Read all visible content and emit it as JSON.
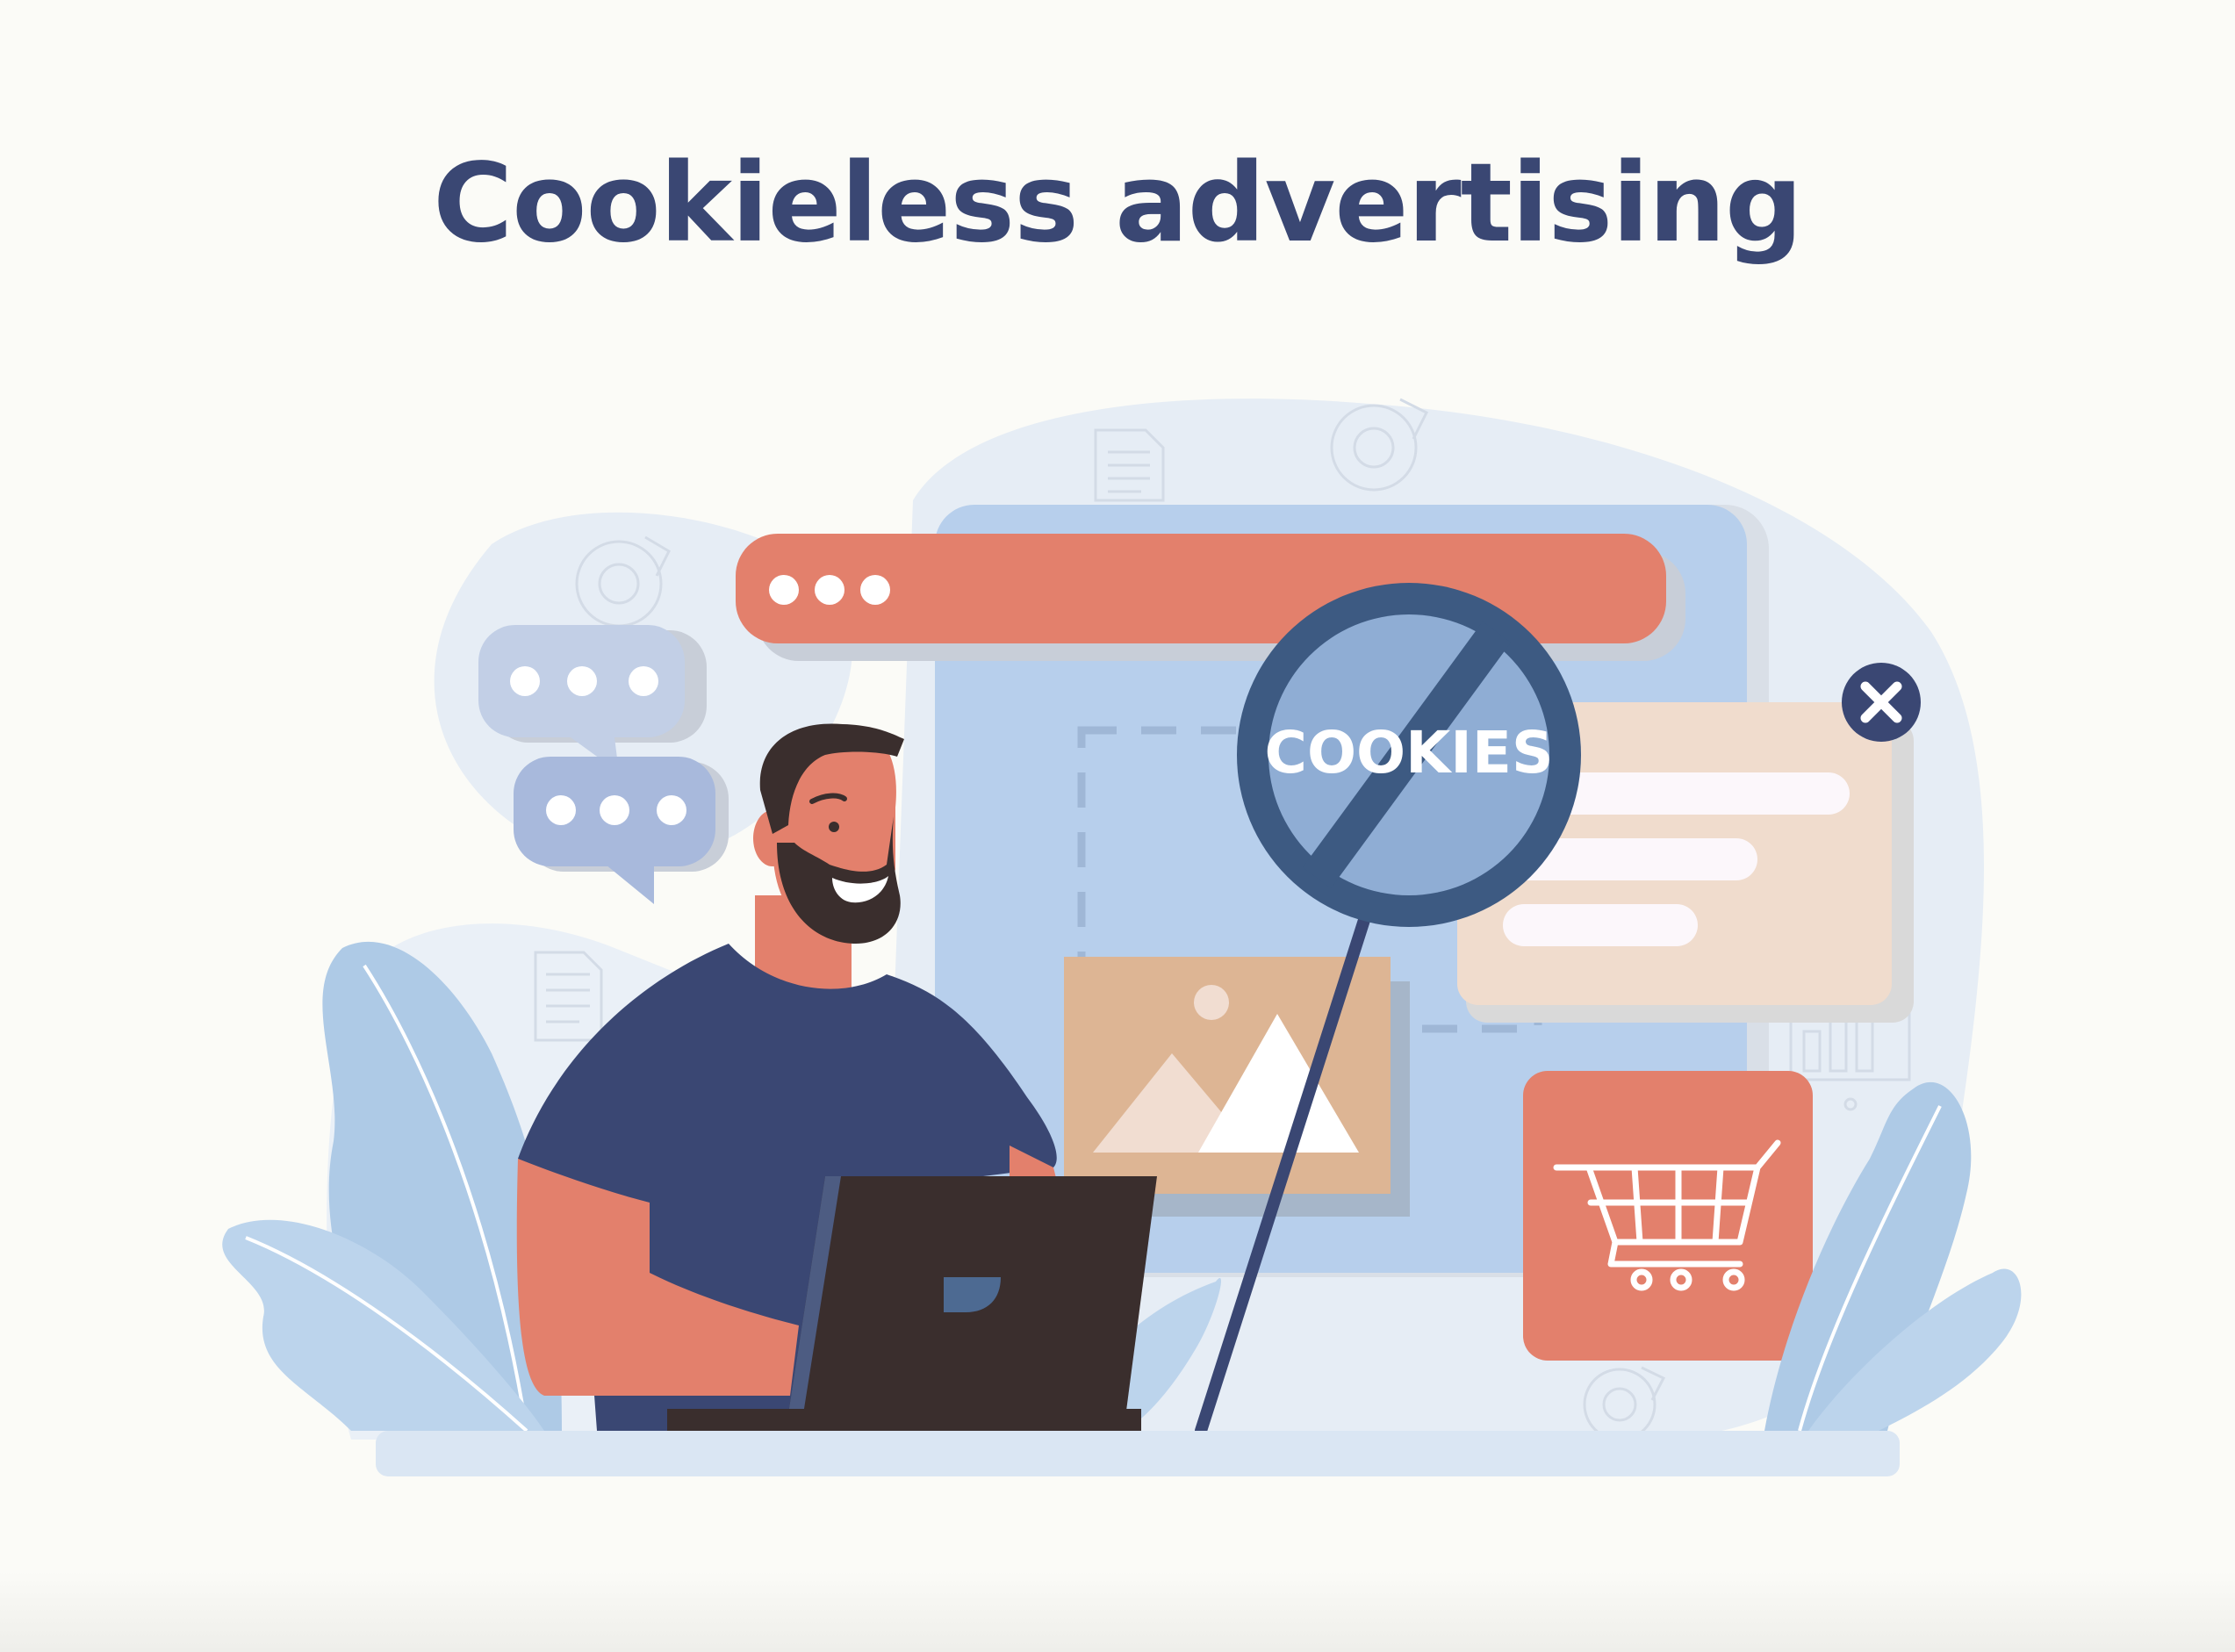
{
  "page": {
    "title": "Cookieless advertising"
  },
  "illustration": {
    "sign_text": "COOKIES",
    "icons": [
      "chat-bubble-icon",
      "document-icon",
      "pie-chart-icon",
      "bar-chart-icon",
      "image-placeholder-icon",
      "shopping-cart-icon",
      "close-icon",
      "laptop-icon"
    ]
  },
  "colors": {
    "title": "#3a4773",
    "accent_coral": "#e3806c",
    "browser_blue": "#b7cfec",
    "navy": "#3d5a82",
    "sign_fill": "#8fadd4",
    "popup_beige": "#f0dccd",
    "image_tan": "#ddb594",
    "shirt": "#3a4773",
    "laptop": "#3a2e2d"
  }
}
